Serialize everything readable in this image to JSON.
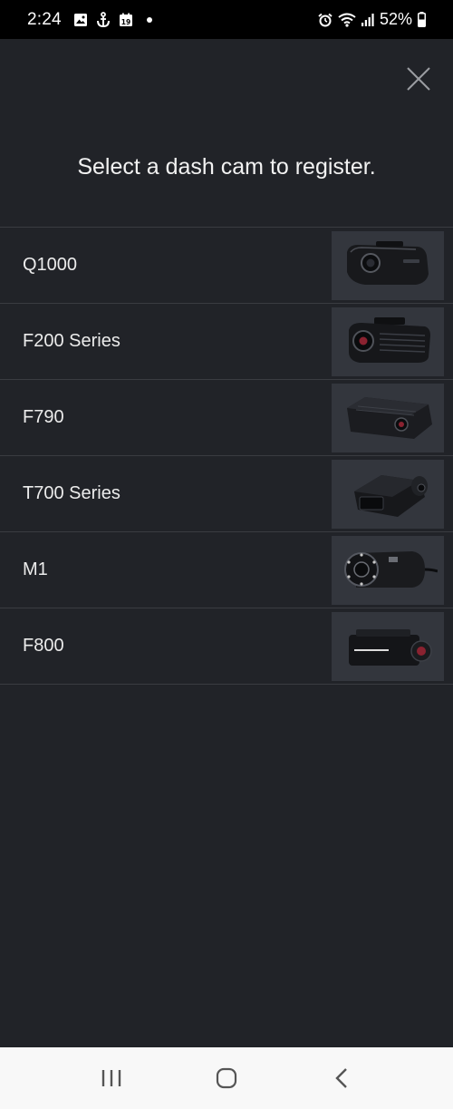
{
  "status_bar": {
    "time": "2:24",
    "battery_percent": "52%",
    "left_icons": [
      "gallery-icon",
      "anchor-notification-icon",
      "calendar-icon",
      "dot"
    ],
    "right_icons": [
      "alarm-icon",
      "wifi-icon",
      "signal-icon",
      "battery-icon"
    ],
    "calendar_day": "19"
  },
  "header": {
    "title": "Select a dash cam to register."
  },
  "models": [
    {
      "name": "Q1000"
    },
    {
      "name": "F200 Series"
    },
    {
      "name": "F790"
    },
    {
      "name": "T700 Series"
    },
    {
      "name": "M1"
    },
    {
      "name": "F800"
    }
  ],
  "nav_bar": {
    "buttons": [
      "recents-button",
      "home-button",
      "back-button"
    ]
  },
  "colors": {
    "background": "#212328",
    "divider": "#3a3c41",
    "thumbnail_bg": "#33363d",
    "text": "#ececec"
  }
}
